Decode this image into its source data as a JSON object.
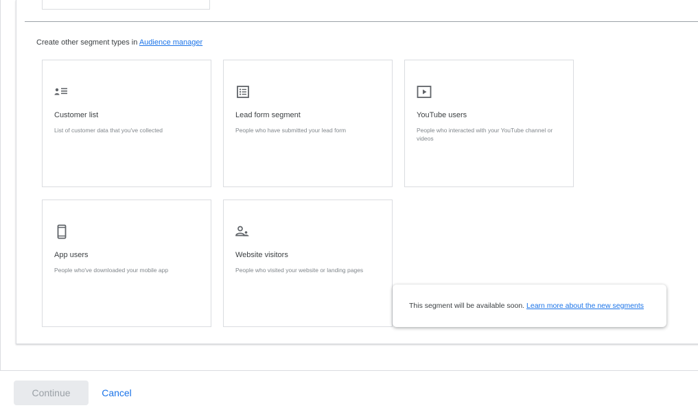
{
  "section": {
    "intro_text": "Create other segment types in ",
    "intro_link": "Audience manager"
  },
  "tiles": [
    {
      "title": "Customer list",
      "description": "List of customer data that you've collected",
      "icon": "customer-list-icon"
    },
    {
      "title": "Lead form segment",
      "description": "People who have submitted your lead form",
      "icon": "lead-form-icon"
    },
    {
      "title": "YouTube users",
      "description": "People who interacted with your YouTube channel or videos",
      "icon": "youtube-play-icon"
    },
    {
      "title": "App users",
      "description": "People who've downloaded your mobile app",
      "icon": "mobile-phone-icon"
    },
    {
      "title": "Website visitors",
      "description": "People who visited your website or landing pages",
      "icon": "website-visitor-icon"
    }
  ],
  "tooltip": {
    "text": "This segment will be available soon. ",
    "link": "Learn more about the new segments"
  },
  "footer": {
    "continue_label": "Continue",
    "cancel_label": "Cancel"
  },
  "colors": {
    "accent": "#1a73e8",
    "icon": "#5f6368",
    "disabled_bg": "#e8eaed",
    "disabled_text": "#9aa0a6"
  }
}
